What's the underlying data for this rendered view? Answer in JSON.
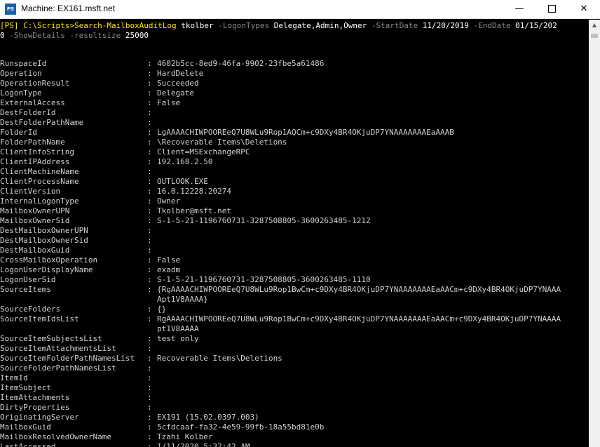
{
  "window": {
    "icon_text": "PS",
    "title": "Machine: EX161.msft.net",
    "controls": {
      "minimize": "—",
      "maximize": "☐",
      "close": "✕"
    }
  },
  "command": {
    "prompt": "[PS] C:\\Scripts>",
    "cmdlet": "Search-MailboxAuditLog",
    "arg": " tkolber ",
    "p1": "-LogonTypes",
    "v1": " Delegate,Admin,Owner ",
    "p2": "-StartDate",
    "v2": " 11/20/2019 ",
    "p3": "-EndDate",
    "v3": " 01/15/202",
    "v3b": "0 ",
    "p4": "-ShowDetails",
    "p5": " -resultsize",
    "v5": " 25000"
  },
  "rows": [
    {
      "k": "RunspaceId",
      "v": "4602b5cc-8ed9-46fa-9902-23fbe5a61486"
    },
    {
      "k": "Operation",
      "v": "HardDelete"
    },
    {
      "k": "OperationResult",
      "v": "Succeeded"
    },
    {
      "k": "LogonType",
      "v": "Delegate"
    },
    {
      "k": "ExternalAccess",
      "v": "False"
    },
    {
      "k": "DestFolderId",
      "v": ""
    },
    {
      "k": "DestFolderPathName",
      "v": ""
    },
    {
      "k": "FolderId",
      "v": "LgAAAACHIWPOOREeQ7U8WLu9Rop1AQCm+c9DXy4BR4OKjuDP7YNAAAAAAAEaAAAB"
    },
    {
      "k": "FolderPathName",
      "v": "\\Recoverable Items\\Deletions"
    },
    {
      "k": "ClientInfoString",
      "v": "Client=MSExchangeRPC"
    },
    {
      "k": "ClientIPAddress",
      "v": "192.168.2.50"
    },
    {
      "k": "ClientMachineName",
      "v": ""
    },
    {
      "k": "ClientProcessName",
      "v": "OUTLOOK.EXE"
    },
    {
      "k": "ClientVersion",
      "v": "16.0.12228.20274"
    },
    {
      "k": "InternalLogonType",
      "v": "Owner"
    },
    {
      "k": "MailboxOwnerUPN",
      "v": "Tkolber@msft.net"
    },
    {
      "k": "MailboxOwnerSid",
      "v": "S-1-5-21-1196760731-3287508805-3600263485-1212"
    },
    {
      "k": "DestMailboxOwnerUPN",
      "v": ""
    },
    {
      "k": "DestMailboxOwnerSid",
      "v": ""
    },
    {
      "k": "DestMailboxGuid",
      "v": ""
    },
    {
      "k": "CrossMailboxOperation",
      "v": "False"
    },
    {
      "k": "LogonUserDisplayName",
      "v": "exadm"
    },
    {
      "k": "LogonUserSid",
      "v": "S-1-5-21-1196760731-3287508805-3600263485-1110"
    },
    {
      "k": "SourceItems",
      "v": "{RgAAAACHIWPOOREeQ7U8WLu9Rop1BwCm+c9DXy4BR4OKjuDP7YNAAAAAAAEaAACm+c9DXy4BR4OKjuDP7YNAAA",
      "v2": "Apt1V8AAAA}"
    },
    {
      "k": "SourceFolders",
      "v": "{}"
    },
    {
      "k": "SourceItemIdsList",
      "v": "RgAAAACHIWPOOREeQ7U8WLu9Rop1BwCm+c9DXy4BR4OKjuDP7YNAAAAAAAEaAACm+c9DXy4BR4OKjuDP7YNAAAA",
      "v2": "pt1V8AAAA"
    },
    {
      "k": "SourceItemSubjectsList",
      "v": "test only"
    },
    {
      "k": "SourceItemAttachmentsList",
      "v": ""
    },
    {
      "k": "SourceItemFolderPathNamesList",
      "v": "Recoverable Items\\Deletions"
    },
    {
      "k": "SourceFolderPathNamesList",
      "v": ""
    },
    {
      "k": "ItemId",
      "v": ""
    },
    {
      "k": "ItemSubject",
      "v": ""
    },
    {
      "k": "ItemAttachments",
      "v": ""
    },
    {
      "k": "DirtyProperties",
      "v": ""
    },
    {
      "k": "OriginatingServer",
      "v": "EX191 (15.02.0397.003)"
    },
    {
      "k": "MailboxGuid",
      "v": "5cfdcaaf-fa32-4e59-99fb-18a55bd81e0b"
    },
    {
      "k": "MailboxResolvedOwnerName",
      "v": "Tzahi Kolber"
    },
    {
      "k": "LastAccessed",
      "v": "1/11/2020 5:32:42 AM"
    }
  ],
  "colors": {
    "background": "#000000",
    "text": "#d0d0d0",
    "command": "#ffe600",
    "param": "#8a8a8a"
  }
}
